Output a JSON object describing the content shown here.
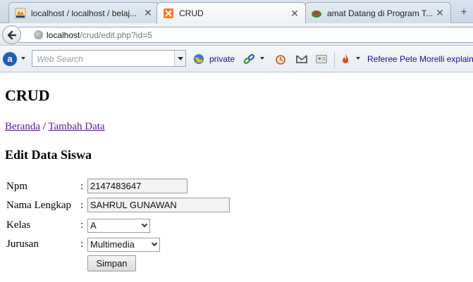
{
  "browser": {
    "tabs": [
      {
        "title": "localhost / localhost / belaj...",
        "favicon": "phpmyadmin-icon",
        "active": false
      },
      {
        "title": "CRUD",
        "favicon": "xampp-icon",
        "active": true
      },
      {
        "title": "amat Datang di Program T...",
        "favicon": "app-icon",
        "active": false
      }
    ],
    "new_tab_label": "+",
    "url": {
      "host": "localhost",
      "path": "/crud/edit.php?id=5"
    }
  },
  "toolbar": {
    "search_placeholder": "Web Search",
    "private_label": "private",
    "news_label": "Referee Pete Morelli explain..."
  },
  "page": {
    "title": "CRUD",
    "breadcrumb": {
      "home": "Beranda",
      "separator": "/",
      "add": "Tambah Data"
    },
    "heading": "Edit Data Siswa",
    "form": {
      "npm": {
        "label": "Npm",
        "value": "2147483647"
      },
      "nama": {
        "label": "Nama Lengkap",
        "value": "SAHRUL GUNAWAN"
      },
      "kelas": {
        "label": "Kelas",
        "value": "A"
      },
      "jurusan": {
        "label": "Jurusan",
        "value": "Multimedia"
      },
      "colon": ":",
      "submit_label": "Simpan"
    }
  }
}
